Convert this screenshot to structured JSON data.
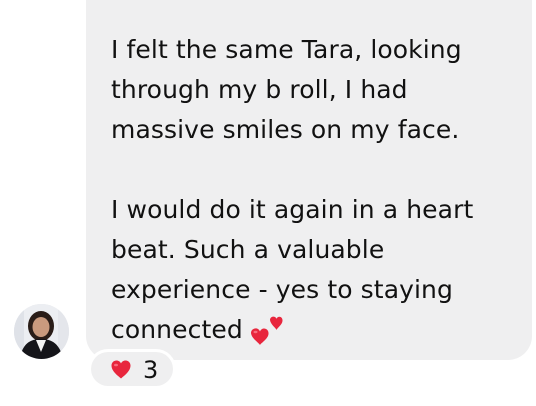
{
  "message": {
    "lines": [
      "I felt the same Tara, looking",
      "through my b roll, I had",
      "massive smiles on my face.",
      "",
      "I would do it again in a heart",
      "beat. Such a valuable",
      "experience - yes to staying",
      "connected"
    ],
    "trailing_emoji": "two-hearts-icon"
  },
  "reaction": {
    "emoji": "red-heart-icon",
    "count": "3"
  },
  "colors": {
    "bubble": "#efeff0",
    "text": "#111111",
    "heart": "#e8263d"
  }
}
